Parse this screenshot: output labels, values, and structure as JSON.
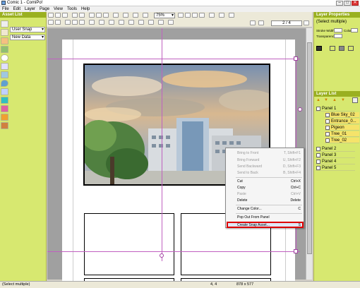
{
  "window": {
    "title": "Comic 1 - ComiPo!",
    "buttons": [
      "–",
      "□",
      "✕"
    ]
  },
  "menu": [
    "File",
    "Edit",
    "Layer",
    "Page",
    "View",
    "Tools",
    "Help"
  ],
  "toolbar": {
    "zoom": "75%",
    "page_nav": "2 / 4"
  },
  "asset_list": {
    "title": "Asset List",
    "dropdown1": "User Snap",
    "dropdown2": "New Data",
    "icons": [
      "square-icon",
      "panel-icon",
      "character-icon",
      "speech-balloon-icon",
      "effect-icon",
      "background-icon",
      "drop-icon",
      "color-icon",
      "tone-icon",
      "frame-icon",
      "book-icon",
      "misc-icon"
    ]
  },
  "context_menu": {
    "items": [
      {
        "label": "Bring to Front",
        "key": "T, Shift+F1",
        "disabled": true
      },
      {
        "label": "Bring Forward",
        "key": "U, Shift+F2",
        "disabled": true
      },
      {
        "label": "Send Backward",
        "key": "D, Shift+F3",
        "disabled": true
      },
      {
        "label": "Send to Back",
        "key": "B, Shift+F4",
        "disabled": true
      },
      {
        "label": "Cut",
        "key": "Ctrl+X",
        "disabled": false
      },
      {
        "label": "Copy",
        "key": "Ctrl+C",
        "disabled": false
      },
      {
        "label": "Paste",
        "key": "Ctrl+V",
        "disabled": true
      },
      {
        "label": "Delete",
        "key": "Delete",
        "disabled": false
      },
      {
        "label": "Change Color...",
        "key": "C",
        "disabled": false
      },
      {
        "label": "Pop Out From Panel",
        "key": "",
        "disabled": false
      },
      {
        "label": "Create Snap Asset...",
        "key": "S",
        "disabled": false
      }
    ]
  },
  "layer_properties": {
    "title": "Layer Properties",
    "selection": "(Select multiple)",
    "stroke_width_label": "Stroke Width",
    "transparency_label": "Transparency",
    "color_label": "Color"
  },
  "layer_list": {
    "title": "Layer List",
    "layers": [
      {
        "name": "Panel 1",
        "level": 0,
        "selected": false
      },
      {
        "name": "Blue Sky_02",
        "level": 1,
        "selected": true
      },
      {
        "name": "Entrance_0...",
        "level": 1,
        "selected": true
      },
      {
        "name": "Pigeon",
        "level": 1,
        "selected": true
      },
      {
        "name": "Tree_01",
        "level": 1,
        "selected": true
      },
      {
        "name": "Tree_02",
        "level": 1,
        "selected": true
      },
      {
        "name": "Panel 2",
        "level": 0,
        "selected": false
      },
      {
        "name": "Panel 3",
        "level": 0,
        "selected": false
      },
      {
        "name": "Panel 4",
        "level": 0,
        "selected": false
      },
      {
        "name": "Panel 5",
        "level": 0,
        "selected": false
      }
    ]
  },
  "status": {
    "left": "(Select multiple)",
    "coords": "4, 4",
    "size": "878 x 577"
  },
  "colors": {
    "panel_bg": "#d7e870",
    "panel_header": "#9ab020",
    "highlight": "#d00000",
    "selected_layer": "#f5e36a"
  }
}
